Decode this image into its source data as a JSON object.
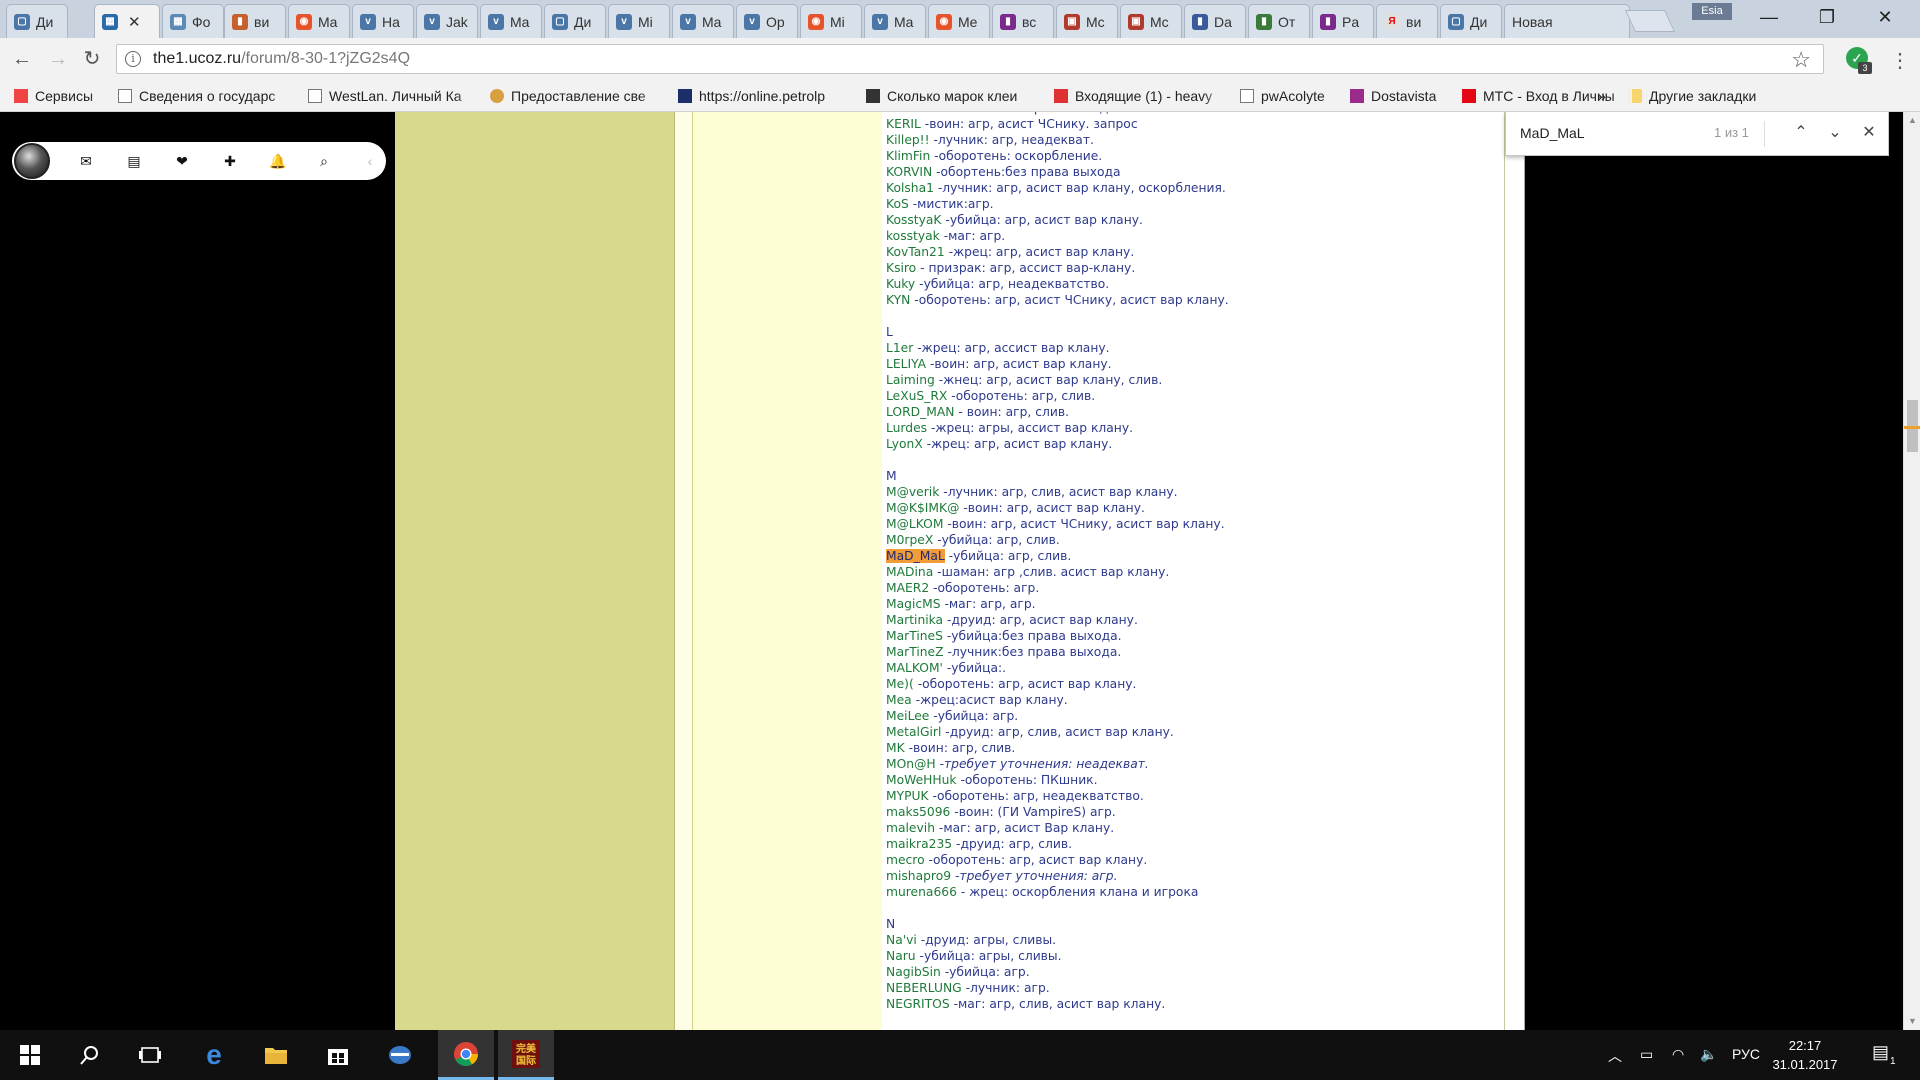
{
  "browser": {
    "tabs": [
      {
        "label": "Ди",
        "fav_color": "#4a76a8",
        "fav": "▢"
      },
      {
        "label": "",
        "fav_color": "#2b6aa8",
        "fav": "▦",
        "active": true,
        "close": "✕"
      },
      {
        "label": "Фо",
        "fav_color": "#5b8bb4",
        "fav": "▦"
      },
      {
        "label": "ви",
        "fav_color": "#c6602e",
        "fav": "▮"
      },
      {
        "label": "Ma",
        "fav_color": "#e5542a",
        "fav": "◉"
      },
      {
        "label": "На",
        "fav_color": "#4a76a8",
        "fav": "v"
      },
      {
        "label": "Jak",
        "fav_color": "#4a76a8",
        "fav": "v"
      },
      {
        "label": "Ma",
        "fav_color": "#4a76a8",
        "fav": "v"
      },
      {
        "label": "Ди",
        "fav_color": "#4a76a8",
        "fav": "▢"
      },
      {
        "label": "Mi",
        "fav_color": "#4a76a8",
        "fav": "v"
      },
      {
        "label": "Ma",
        "fav_color": "#4a76a8",
        "fav": "v"
      },
      {
        "label": "Op",
        "fav_color": "#4a76a8",
        "fav": "v"
      },
      {
        "label": "Mi",
        "fav_color": "#e5542a",
        "fav": "◉"
      },
      {
        "label": "Ma",
        "fav_color": "#4a76a8",
        "fav": "v"
      },
      {
        "label": "Me",
        "fav_color": "#e5542a",
        "fav": "◉"
      },
      {
        "label": "вс",
        "fav_color": "#7a2a8a",
        "fav": "▮"
      },
      {
        "label": "Mc",
        "fav_color": "#b03a2e",
        "fav": "▣"
      },
      {
        "label": "Mc",
        "fav_color": "#b03a2e",
        "fav": "▣"
      },
      {
        "label": "Da",
        "fav_color": "#3a5a9a",
        "fav": "▮"
      },
      {
        "label": "От",
        "fav_color": "#3a7a3a",
        "fav": "▮"
      },
      {
        "label": "Pa",
        "fav_color": "#7a2a8a",
        "fav": "▮"
      },
      {
        "label": "ви",
        "fav_color": "#e0e0e0",
        "fav": "Я"
      },
      {
        "label": "Ди",
        "fav_color": "#4a76a8",
        "fav": "▢"
      },
      {
        "label": "Новая",
        "fav_color": "",
        "fav": ""
      }
    ],
    "profile": "Esia",
    "window": {
      "minimize": "—",
      "maximize": "❐",
      "close": "✕"
    },
    "toolbar": {
      "back": "←",
      "forward": "→",
      "reload": "↻",
      "url_host": "the1.ucoz.ru",
      "url_path": "/forum/8-30-1?jZG2s4Q",
      "info": "i",
      "star": "☆",
      "menu": "⋮",
      "ext_badge": "3",
      "ext_glyph": "✓"
    },
    "bookmarks": [
      {
        "label": "Сервисы",
        "icon": "apps-grid-icon"
      },
      {
        "label": "Сведения о государс",
        "icon": "page-icon"
      },
      {
        "label": "WestLan. Личный Ка",
        "icon": "page-icon"
      },
      {
        "label": "Предоставление све",
        "icon": "globe-icon"
      },
      {
        "label": "https://online.petrolp",
        "icon": "petrol-icon"
      },
      {
        "label": "Сколько марок клеи",
        "icon": "a-icon"
      },
      {
        "label": "Входящие (1) - heavy",
        "icon": "gmail-icon"
      },
      {
        "label": "pwAcolyte",
        "icon": "page-icon"
      },
      {
        "label": "Dostavista",
        "icon": "d-icon"
      },
      {
        "label": "МТС - Вход в Личны",
        "icon": "mts-icon"
      }
    ],
    "bookmarks_more": "»",
    "bookmarks_other": "Другие закладки"
  },
  "userbar": {
    "icons": [
      "mail-icon",
      "notes-icon",
      "chat-icon",
      "add-icon",
      "bell-icon",
      "search-icon",
      "collapse-icon"
    ],
    "glyphs": [
      "✉",
      "▤",
      "❤",
      "✚",
      "🔔",
      "⌕",
      "‹"
    ]
  },
  "findbar": {
    "query": "MaD_MaL",
    "count": "1 из 1",
    "prev": "⌃",
    "next": "⌄",
    "close": "✕"
  },
  "post": {
    "lines": [
      {
        "nick": "KEEPER",
        "desc": " - мистик: без права выхода"
      },
      {
        "nick": "KERIL",
        "desc": " -воин: агр, асист ЧСнику. запрос"
      },
      {
        "nick": "Killep!!",
        "desc": " -лучник: агр, неадекват."
      },
      {
        "nick": "KlimFin",
        "desc": " -оборотень: оскорбление."
      },
      {
        "nick": "KORVIN",
        "desc": " -обортень:без права выхода"
      },
      {
        "nick": "Kolsha1",
        "desc": " -лучник: агр, асист вар клану, оскорбления."
      },
      {
        "nick": "KoS",
        "desc": " -мистик:агр."
      },
      {
        "nick": "KosstyaK",
        "desc": " -убийца: агр, асист вар клану."
      },
      {
        "nick": "kosstyak",
        "desc": " -маг: агр."
      },
      {
        "nick": "KovTan21",
        "desc": " -жрец: агр, асист вар клану."
      },
      {
        "nick": "Ksiro",
        "desc": " - призрак: агр, ассист вар-клану."
      },
      {
        "nick": "Kuky",
        "desc": " -убийца: агр, неадекватство."
      },
      {
        "nick": "KYN",
        "desc": " -оборотень: агр, асист ЧСнику, асист вар клану."
      },
      {
        "gap": true
      },
      {
        "letter": "L"
      },
      {
        "nick": "L1er",
        "desc": " -жрец: агр, ассист вар клану."
      },
      {
        "nick": "LELIYA",
        "desc": " -воин: агр, асист вар клану."
      },
      {
        "nick": "Laiming",
        "desc": " -жнец: агр, асист вар клану, слив."
      },
      {
        "nick": "LeXuS_RX",
        "desc": " -оборотень: агр, слив."
      },
      {
        "nick": "LORD_MAN",
        "desc": " - воин: агр, слив."
      },
      {
        "nick": "Lurdes",
        "desc": " -жрец: агры, ассист вар клану."
      },
      {
        "nick": "LyonX",
        "desc": " -жрец: агр, асист вар клану."
      },
      {
        "gap": true
      },
      {
        "letter": "M"
      },
      {
        "nick": "M@verik",
        "desc": " -лучник: агр, слив, асист вар клану."
      },
      {
        "nick": "M@K$IMK@",
        "desc": " -воин: агр, асист вар клану."
      },
      {
        "nick": "M@LKOM",
        "desc": " -воин: агр, асист ЧСнику, асист вар клану."
      },
      {
        "nick": "M0rpeX",
        "desc": " -убийца: агр, слив."
      },
      {
        "nick": "MaD_MaL",
        "desc": " -убийца: агр, слив.",
        "highlight": true
      },
      {
        "nick": "MADina",
        "desc": " -шаман: агр ,слив. асист вар клану."
      },
      {
        "nick": "MAER2",
        "desc": " -оборотень: агр."
      },
      {
        "nick": "MagicMS",
        "desc": " -маг: агр, агр."
      },
      {
        "nick": "Martinika",
        "desc": " -друид: агр, асист вар клану."
      },
      {
        "nick": "MarTineS",
        "desc": " -убийца:без права выхода."
      },
      {
        "nick": "MarTineZ",
        "desc": " -лучник:без права выхода."
      },
      {
        "nick": "MALKOM'",
        "desc": " -убийца:."
      },
      {
        "nick": "Me)(",
        "desc": " -оборотень: агр, асист вар клану."
      },
      {
        "nick": "Mea",
        "desc": " -жрец:асист вар клану."
      },
      {
        "nick": "MeiLee",
        "desc": " -убийца: агр."
      },
      {
        "nick": "MetalGirl",
        "desc": " -друид: агр, слив, асист вар клану."
      },
      {
        "nick": "MK",
        "desc": " -воин: агр, слив."
      },
      {
        "nick": "MOn@H",
        "desc": " -требует уточнения: неадекват.",
        "italic_part": true
      },
      {
        "nick": "MoWeHHuk",
        "desc": " -оборотень: ПКшник."
      },
      {
        "nick": "MYPUK",
        "desc": " -оборотень: агр, неадекватство."
      },
      {
        "nick": "maks5096",
        "desc": " -воин: (ГИ VampireS) агр."
      },
      {
        "nick": "malevih",
        "desc": " -маг: агр, асист Вар клану."
      },
      {
        "nick": "maikra235",
        "desc": " -друид: агр, слив."
      },
      {
        "nick": "mecro",
        "desc": " -оборотень: агр, асист вар клану."
      },
      {
        "nick": "mishapro9",
        "desc": " -требует уточнения: агр.",
        "italic_part": true
      },
      {
        "nick": "murena666",
        "desc": " - жрец: оскорбления клана и игрока"
      },
      {
        "gap": true
      },
      {
        "letter": "N"
      },
      {
        "nick": "Na'vi",
        "desc": " -друид: агры, сливы."
      },
      {
        "nick": "Naru",
        "desc": " -убийца: агры, сливы."
      },
      {
        "nick": "NagibSin",
        "desc": " -убийца: агр."
      },
      {
        "nick": "NEBERLUNG",
        "desc": " -лучник: агр."
      },
      {
        "nick": "NEGRITOS",
        "desc": " -маг: агр, слив, асист вар клану."
      }
    ]
  },
  "taskbar": {
    "lang": "РУС",
    "time": "22:17",
    "date": "31.01.2017",
    "notif_count": "1"
  }
}
